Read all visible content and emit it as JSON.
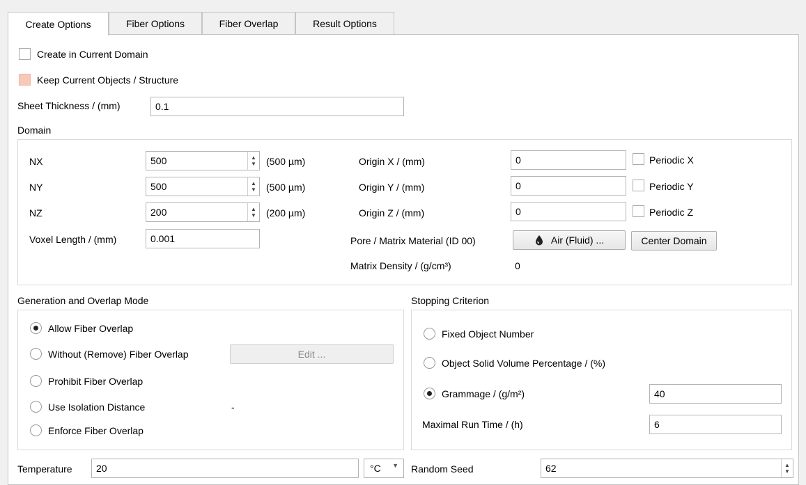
{
  "tabs": [
    "Create Options",
    "Fiber Options",
    "Fiber Overlap",
    "Result Options"
  ],
  "create_in_current_domain": {
    "label": "Create in Current Domain",
    "checked": false
  },
  "keep_current_objects": {
    "label": "Keep Current Objects / Structure",
    "checked": false
  },
  "sheet_thickness": {
    "label": "Sheet Thickness / (mm)",
    "value": "0.1"
  },
  "domain": {
    "title": "Domain",
    "nx": {
      "label": "NX",
      "value": "500",
      "unit": "(500 µm)"
    },
    "ny": {
      "label": "NY",
      "value": "500",
      "unit": "(500 µm)"
    },
    "nz": {
      "label": "NZ",
      "value": "200",
      "unit": "(200 µm)"
    },
    "voxel_length": {
      "label": "Voxel Length / (mm)",
      "value": "0.001"
    },
    "origin_x": {
      "label": "Origin X / (mm)",
      "value": "0"
    },
    "origin_y": {
      "label": "Origin Y / (mm)",
      "value": "0"
    },
    "origin_z": {
      "label": "Origin Z / (mm)",
      "value": "0"
    },
    "periodic_x": "Periodic X",
    "periodic_y": "Periodic Y",
    "periodic_z": "Periodic Z",
    "pore_material_label": "Pore / Matrix Material (ID 00)",
    "pore_material_button": "Air (Fluid) ...",
    "center_domain_button": "Center Domain",
    "matrix_density_label": "Matrix Density / (g/cm³)",
    "matrix_density_value": "0"
  },
  "generation": {
    "title": "Generation and Overlap Mode",
    "options": [
      "Allow Fiber Overlap",
      "Without (Remove) Fiber Overlap",
      "Prohibit Fiber Overlap",
      "Use Isolation Distance",
      "Enforce Fiber Overlap"
    ],
    "selected": "Allow Fiber Overlap",
    "edit_button": "Edit ...",
    "isolation_value": "-"
  },
  "stopping": {
    "title": "Stopping Criterion",
    "options": [
      "Fixed Object Number",
      "Object Solid Volume Percentage / (%)",
      "Grammage / (g/m²)"
    ],
    "selected": "Grammage / (g/m²)",
    "grammage_value": "40",
    "max_runtime_label": "Maximal Run Time / (h)",
    "max_runtime_value": "6"
  },
  "temperature": {
    "label": "Temperature",
    "value": "20",
    "unit": "°C"
  },
  "random_seed": {
    "label": "Random Seed",
    "value": "62"
  },
  "colors": {
    "checkbox_tint": "#f8c8b8",
    "panel_bg": "#ffffff",
    "window_bg": "#f0f0f0"
  },
  "icons": {
    "pore_material": "droplet-icon",
    "spin_up": "chevron-up-icon",
    "spin_down": "chevron-down-icon",
    "combo": "chevron-down-icon"
  }
}
